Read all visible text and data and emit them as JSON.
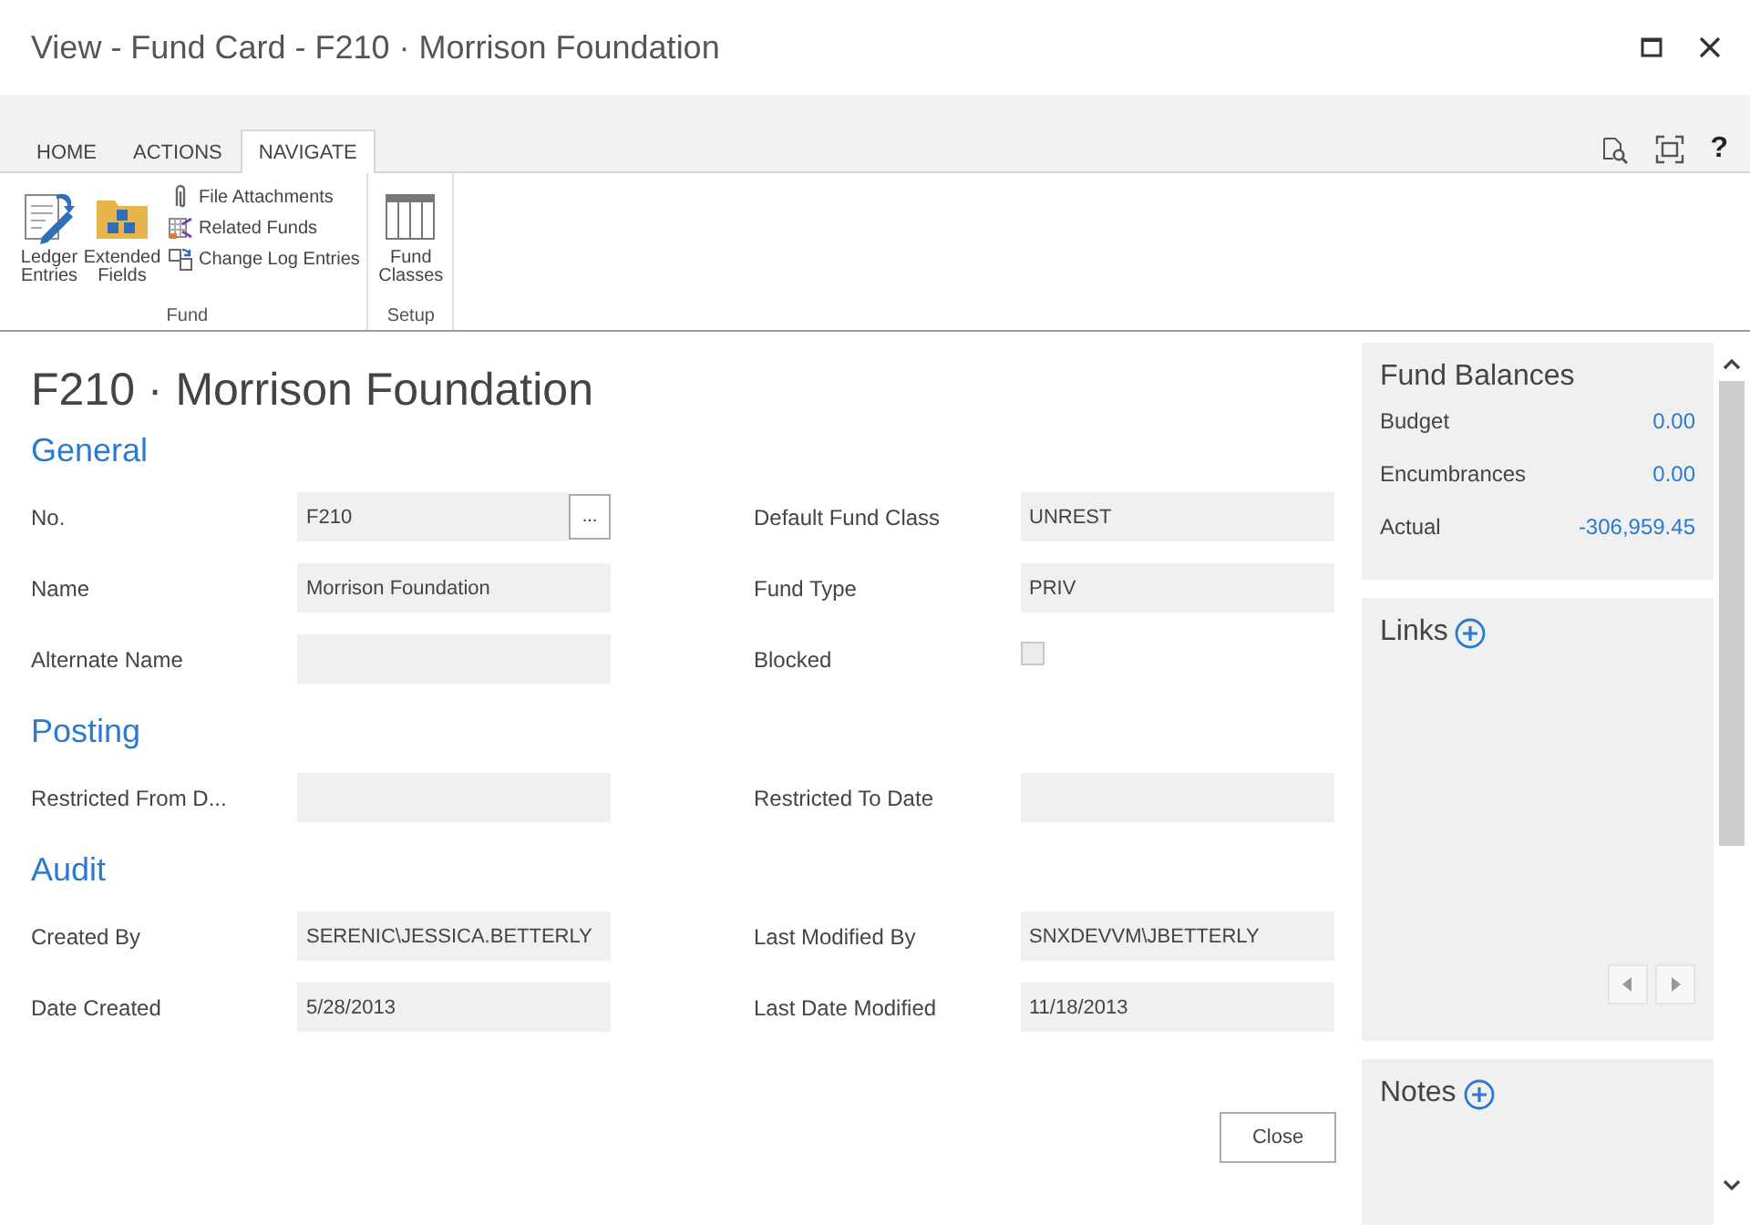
{
  "window": {
    "title": "View - Fund Card - F210 · Morrison Foundation"
  },
  "tabs": [
    {
      "label": "HOME",
      "selected": false
    },
    {
      "label": "ACTIONS",
      "selected": false
    },
    {
      "label": "NAVIGATE",
      "selected": true
    }
  ],
  "ribbon_groups": [
    {
      "label": "Fund",
      "large_items": [
        "Ledger Entries",
        "Extended Fields"
      ],
      "small_items": [
        "File Attachments",
        "Related Funds",
        "Change Log Entries"
      ]
    },
    {
      "label": "Setup",
      "large_items": [
        "Fund Classes"
      ]
    }
  ],
  "help_button": "?",
  "page_title": "F210 · Morrison Foundation",
  "sections": [
    {
      "title": "General",
      "fields": [
        {
          "label": "No.",
          "kind": "lookup",
          "value": "F210",
          "button": "..."
        },
        {
          "label": "Default Fund Class",
          "kind": "text",
          "value": "UNREST"
        },
        {
          "label": "Name",
          "kind": "text",
          "value": "Morrison Foundation"
        },
        {
          "label": "Fund Type",
          "kind": "text",
          "value": "PRIV"
        },
        {
          "label": "Alternate Name",
          "kind": "text"
        },
        {
          "label": "Blocked",
          "kind": "checkbox",
          "checked": false
        }
      ]
    },
    {
      "title": "Posting",
      "fields": [
        {
          "label": "Restricted From D...",
          "kind": "text"
        },
        {
          "label": "Restricted To Date",
          "kind": "text"
        }
      ]
    },
    {
      "title": "Audit",
      "fields": [
        {
          "label": "Created By",
          "kind": "text",
          "value": "SERENIC\\JESSICA.BETTERLY"
        },
        {
          "label": "Last Modified By",
          "kind": "text",
          "value": "SNXDEVVM\\JBETTERLY"
        },
        {
          "label": "Date Created",
          "kind": "text",
          "value": "5/28/2013"
        },
        {
          "label": "Last Date Modified",
          "kind": "text",
          "value": "11/18/2013"
        }
      ]
    }
  ],
  "close_button": "Close",
  "factbox": {
    "balances": {
      "title": "Fund Balances",
      "rows": [
        {
          "label": "Budget",
          "value": "0.00"
        },
        {
          "label": "Encumbrances",
          "value": "0.00"
        },
        {
          "label": "Actual",
          "value": "-306,959.45"
        }
      ]
    },
    "links": {
      "title": "Links"
    },
    "notes": {
      "title": "Notes"
    }
  }
}
